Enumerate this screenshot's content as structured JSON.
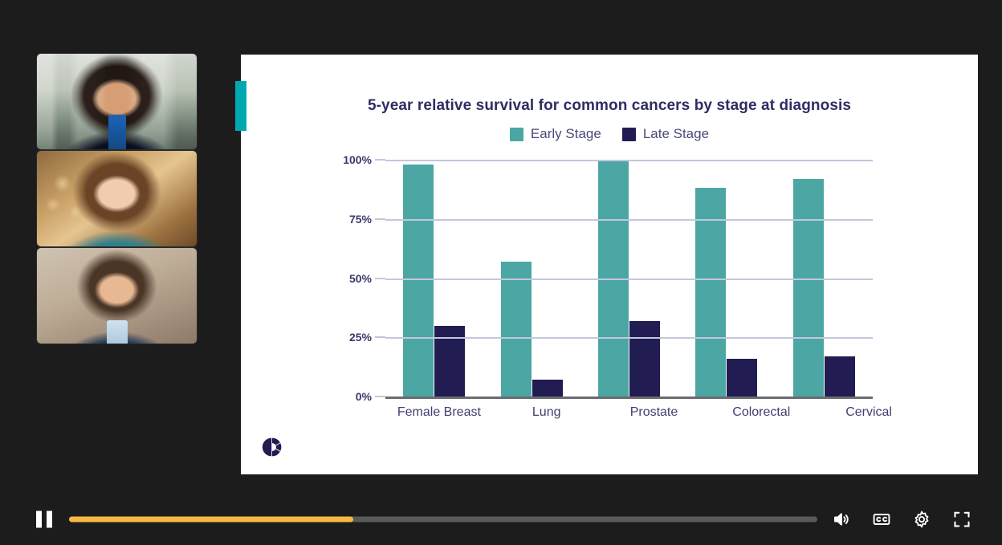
{
  "meeting": {
    "participants": [
      {
        "name": "participant-1",
        "description": "woman with dark hair in dark blazer, bright office background"
      },
      {
        "name": "participant-2",
        "description": "woman with long brown hair in teal patterned top, warm amber background"
      },
      {
        "name": "participant-3",
        "description": "bearded man in navy blazer and light blue shirt, beige wall background"
      }
    ]
  },
  "slide": {
    "logo_icon": "segmented-donut-logo-icon",
    "accent_tab_color": "#00a9b0"
  },
  "chart_data": {
    "type": "bar",
    "title": "5-year relative survival for common cancers by stage at diagnosis",
    "xlabel": "",
    "ylabel": "",
    "categories": [
      "Female Breast",
      "Lung",
      "Prostate",
      "Colorectal",
      "Cervical"
    ],
    "series": [
      {
        "name": "Early Stage",
        "color": "#4ba6a4",
        "values": [
          98,
          57,
          100,
          88,
          92
        ]
      },
      {
        "name": "Late Stage",
        "color": "#211d52",
        "values": [
          30,
          7,
          32,
          16,
          17
        ]
      }
    ],
    "ylim": [
      0,
      100
    ],
    "yticks": [
      "0%",
      "25%",
      "50%",
      "75%",
      "100%"
    ],
    "ytick_values": [
      0,
      25,
      50,
      75,
      100
    ],
    "grid": true,
    "legend_position": "top"
  },
  "player": {
    "play_pause_state": "pause",
    "play_pause_icon": "pause-icon",
    "progress_percent": 38,
    "progress_fill_color": "#f6b944",
    "controls": [
      {
        "name": "volume",
        "icon": "volume-icon"
      },
      {
        "name": "captions",
        "icon": "closed-captions-icon",
        "label": "CC"
      },
      {
        "name": "settings",
        "icon": "gear-icon"
      },
      {
        "name": "fullscreen",
        "icon": "fullscreen-icon"
      }
    ]
  }
}
